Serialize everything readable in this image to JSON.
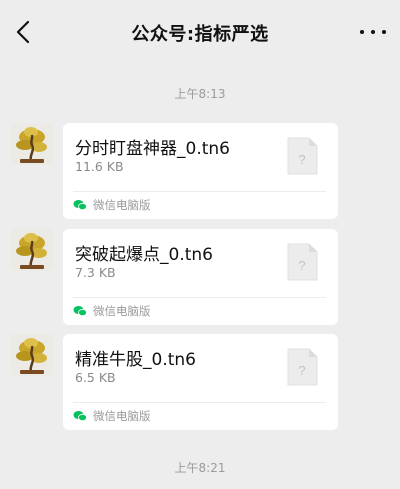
{
  "header": {
    "title": "公众号:指标严选",
    "back_icon": "chevron-left-icon",
    "more_icon": "more-dots-icon"
  },
  "timestamps": [
    "上午8:13",
    "上午8:21"
  ],
  "messages": [
    {
      "file_name": "分时盯盘神器_0.tn6",
      "file_size": "11.6 KB",
      "file_icon": "unknown-file-icon",
      "source": "微信电脑版"
    },
    {
      "file_name": "突破起爆点_0.tn6",
      "file_size": "7.3 KB",
      "file_icon": "unknown-file-icon",
      "source": "微信电脑版"
    },
    {
      "file_name": "精准牛股_0.tn6",
      "file_size": "6.5 KB",
      "file_icon": "unknown-file-icon",
      "source": "微信电脑版"
    }
  ],
  "colors": {
    "background": "#ededed",
    "bubble": "#ffffff",
    "wechat_green": "#07c160"
  }
}
